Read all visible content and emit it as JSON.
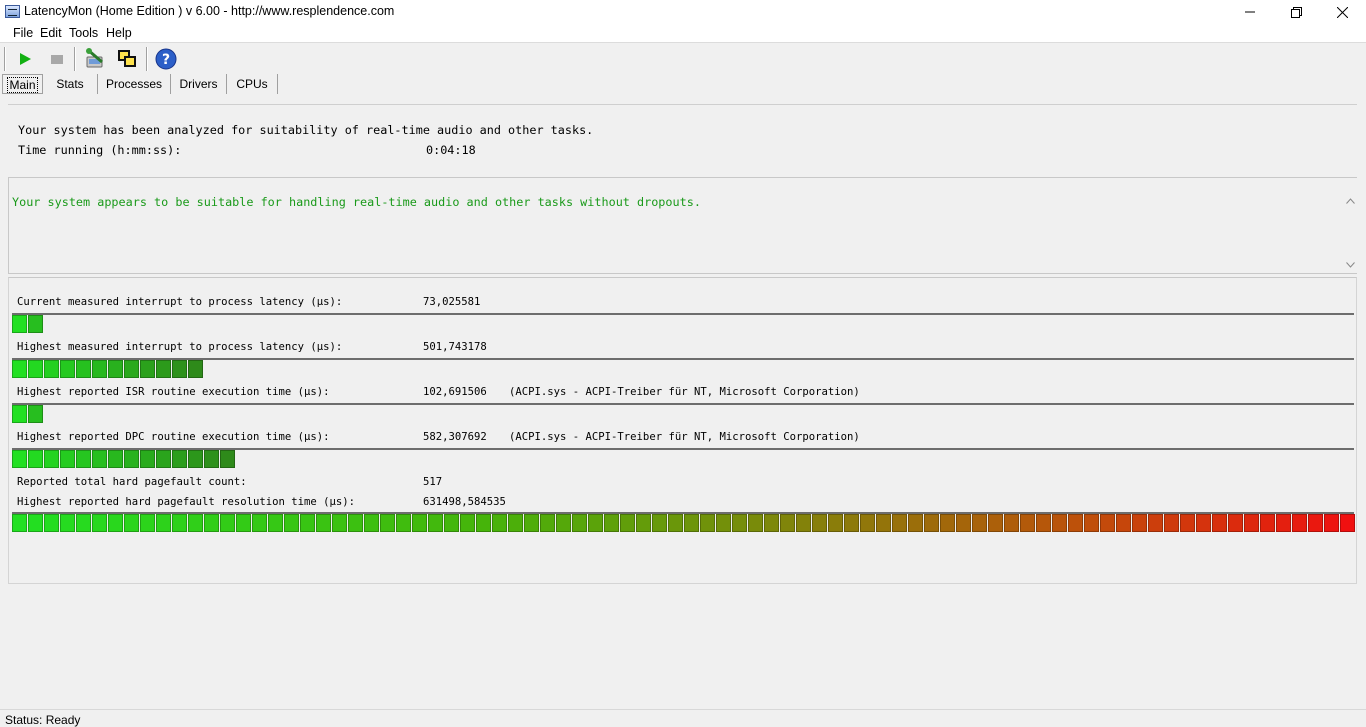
{
  "window": {
    "title": "LatencyMon  (Home Edition )  v 6.00 - http://www.resplendence.com"
  },
  "menu": [
    "File",
    "Edit",
    "Tools",
    "Help"
  ],
  "toolbar": {
    "icons": [
      "play-icon",
      "stop-icon",
      "tools-icon",
      "windows-icon",
      "help-icon"
    ]
  },
  "tabs": [
    {
      "label": "Main",
      "active": true
    },
    {
      "label": "Stats",
      "active": false
    },
    {
      "label": "Processes",
      "active": false
    },
    {
      "label": "Drivers",
      "active": false
    },
    {
      "label": "CPUs",
      "active": false
    }
  ],
  "info": {
    "analyzed_line": "Your system has been analyzed for suitability of real-time audio and other tasks.",
    "time_label": "Time running (h:mm:ss):",
    "time_value": "0:04:18"
  },
  "verdict": {
    "text": "Your system appears to be suitable for handling real-time audio and other tasks without dropouts.",
    "color": "#1a9a1a"
  },
  "metrics": {
    "current_latency": {
      "label": "Current measured interrupt to process latency (µs):",
      "value": "73,025581",
      "bar_segments": 2
    },
    "highest_latency": {
      "label": "Highest measured interrupt to process latency (µs):",
      "value": "501,743178",
      "bar_segments": 12
    },
    "isr": {
      "label": "Highest reported ISR routine execution time (µs):",
      "value": "102,691506",
      "extra": "(ACPI.sys - ACPI-Treiber für NT, Microsoft Corporation)",
      "bar_segments": 2
    },
    "dpc": {
      "label": "Highest reported DPC routine execution time (µs):",
      "value": "582,307692",
      "extra": "(ACPI.sys - ACPI-Treiber für NT, Microsoft Corporation)",
      "bar_segments": 14
    },
    "pagefault_count": {
      "label": "Reported total hard pagefault count:",
      "value": "517"
    },
    "pagefault_time": {
      "label": "Highest reported hard pagefault resolution time (µs):",
      "value": "631498,584535",
      "bar_segments": 84
    }
  },
  "colors": {
    "meter_green_start": "#22e022",
    "meter_green_end": "#2e8a1a",
    "meter_red_end": "#f01010"
  },
  "status": {
    "text": "Status: Ready"
  }
}
